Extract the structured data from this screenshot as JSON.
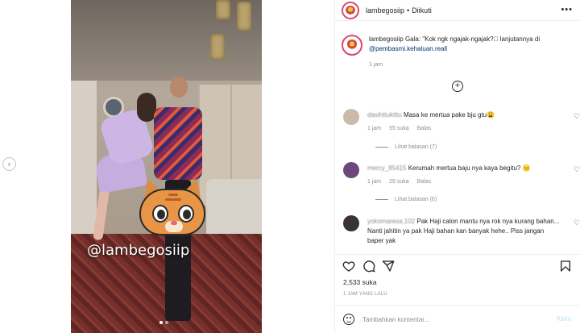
{
  "media": {
    "watermark": "@lambegosiip",
    "carousel_dots": 2,
    "active_dot": 1
  },
  "header": {
    "username": "lambegosiip",
    "separator": "•",
    "follow_status": "Diikuti",
    "more_icon": "more-horizontal-icon"
  },
  "caption": {
    "username": "lambegosiip",
    "text": "Gala: \"Kok ngk ngajak-ngajak?\u0000 lanjutannya di",
    "mention": "@pembasmi.kehaluan.reall",
    "time": "1 jam"
  },
  "comments": [
    {
      "username": "dasihttukittu",
      "text": "Masa ke mertua pake bju gtu😩",
      "time": "1 jam",
      "likes": "55 suka",
      "reply": "Balas",
      "view_replies": "Lihat balasan (7)",
      "avatar_color": "#c9bba8"
    },
    {
      "username": "mercy_85415",
      "text": "Kerumah mertua baju nya kaya begitu? 😑",
      "time": "1 jam",
      "likes": "29 suka",
      "reply": "Balas",
      "view_replies": "Lihat balasan (6)",
      "avatar_color": "#6b4a7a"
    },
    {
      "username": "yokomaresa.102",
      "text": "Pak Haji calon mantu nya rok nya kurang bahan... Nanti jahitin ya pak Haji bahan kan banyak hehe.. Piss jangan baper yak",
      "avatar_color": "#3a3330"
    }
  ],
  "actions": {
    "likes": "2,533 suka",
    "post_time": "1 JAM YANG LALU"
  },
  "comment_box": {
    "placeholder": "Tambahkan komentar...",
    "post_label": "Kirim"
  },
  "colors": {
    "link": "#00376b",
    "secondary_text": "#8e8e8e",
    "avatar_ring": "#d64a6f",
    "post_disabled": "#b2dffc"
  }
}
